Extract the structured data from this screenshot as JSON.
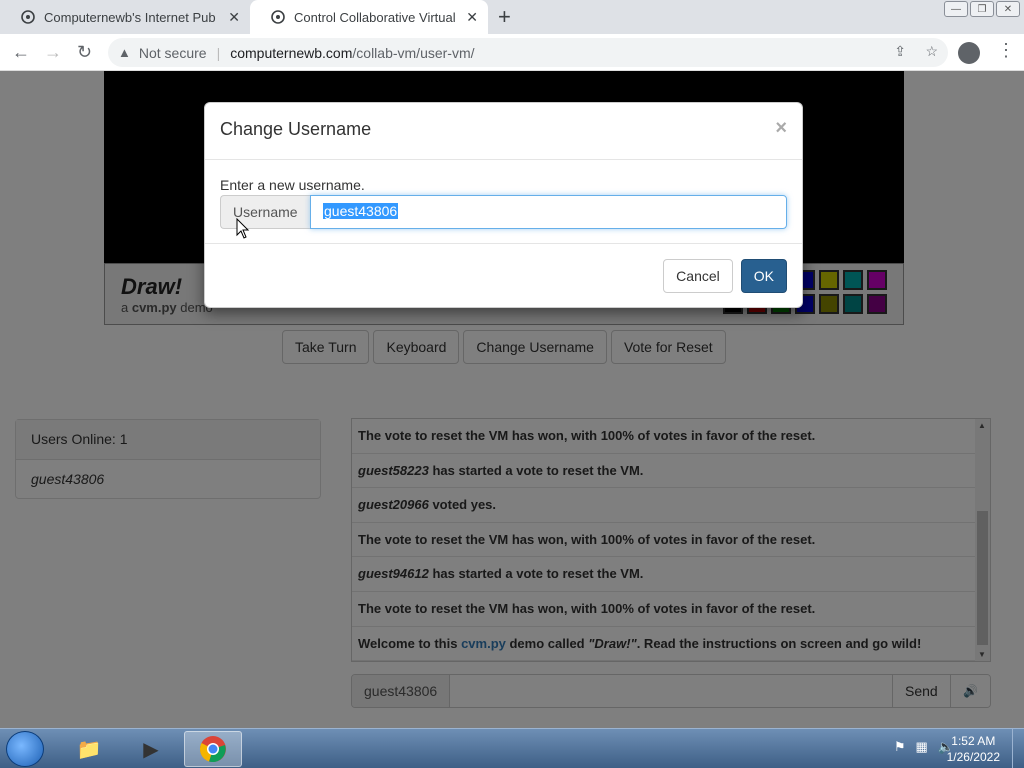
{
  "browser": {
    "tabs": [
      {
        "title": "Computernewb's Internet Pub Hu",
        "active": false
      },
      {
        "title": "Control Collaborative Virtual Mac",
        "active": true
      }
    ],
    "security_label": "Not secure",
    "url_domain": "computernewb.com",
    "url_path": "/collab-vm/user-vm/"
  },
  "page": {
    "draw_title": "Draw!",
    "draw_sub_prefix": "a ",
    "draw_sub_bold": "cvm.py",
    "draw_sub_suffix": " demo",
    "palette_colors": [
      "#0000cc",
      "#cccc00",
      "#00aaaa",
      "#cc00cc",
      "#000000",
      "#cc0000",
      "#008800",
      "#0000cc",
      "#888800",
      "#008888",
      "#880088"
    ],
    "vm_buttons": [
      "Take Turn",
      "Keyboard",
      "Change Username",
      "Vote for Reset"
    ],
    "users_online_label": "Users Online: 1",
    "users": [
      "guest43806"
    ],
    "chat": [
      {
        "user": "",
        "text": "The vote to reset the VM has won, with 100% of votes in favor of the reset."
      },
      {
        "user": "guest58223",
        "text": " has started a vote to reset the VM."
      },
      {
        "user": "guest20966",
        "text": " voted yes."
      },
      {
        "user": "",
        "text": "The vote to reset the VM has won, with 100% of votes in favor of the reset."
      },
      {
        "user": "guest94612",
        "text": " has started a vote to reset the VM."
      },
      {
        "user": "",
        "text": "The vote to reset the VM has won, with 100% of votes in favor of the reset."
      }
    ],
    "welcome_prefix": "Welcome to this ",
    "welcome_link": "cvm.py",
    "welcome_mid": " demo called ",
    "welcome_name": "\"Draw!\"",
    "welcome_suffix": ". Read the instructions on screen and go wild!",
    "chat_username": "guest43806",
    "send_label": "Send"
  },
  "modal": {
    "title": "Change Username",
    "close": "×",
    "prompt": "Enter a new username.",
    "addon_label": "Username",
    "input_value": "guest43806",
    "cancel_label": "Cancel",
    "ok_label": "OK"
  },
  "taskbar": {
    "time": "1:52 AM",
    "date": "1/26/2022"
  }
}
